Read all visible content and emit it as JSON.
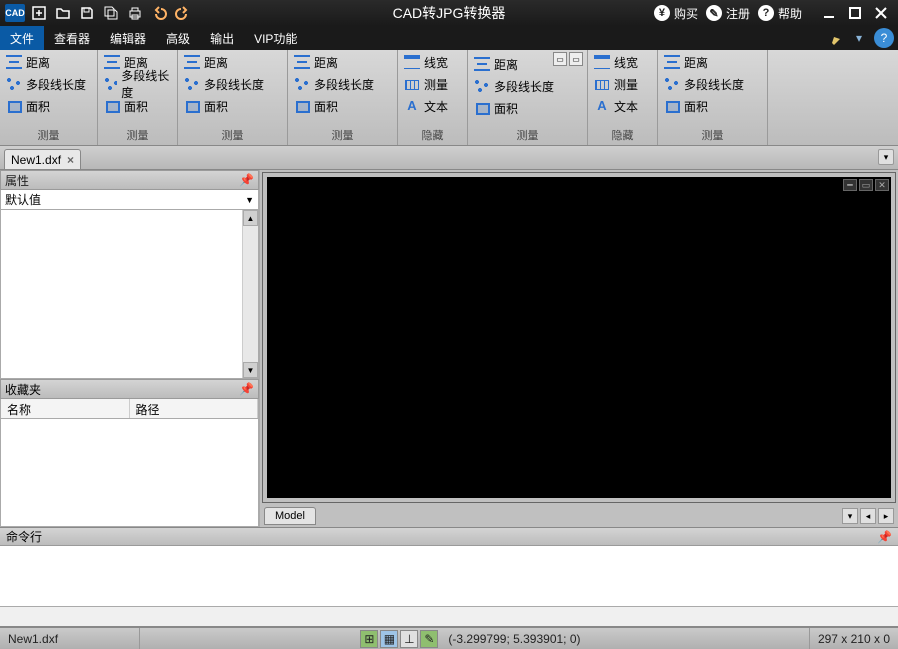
{
  "title": "CAD转JPG转换器",
  "titlebar_right": {
    "buy": "购买",
    "register": "注册",
    "help": "帮助"
  },
  "menu": {
    "file": "文件",
    "viewer": "查看器",
    "editor": "编辑器",
    "advanced": "高级",
    "output": "输出",
    "vip": "VIP功能"
  },
  "ribbon": {
    "distance": "距离",
    "polylen": "多段线长度",
    "area": "面积",
    "linewidth": "线宽",
    "measure": "测量",
    "text": "文本",
    "hide": "隐藏",
    "measure_group": "测量"
  },
  "doc": {
    "tab": "New1.dxf"
  },
  "panels": {
    "properties": "属性",
    "default_value": "默认值",
    "favorites": "收藏夹",
    "col_name": "名称",
    "col_path": "路径",
    "command": "命令行"
  },
  "viewport": {
    "model_tab": "Model"
  },
  "status": {
    "file": "New1.dxf",
    "coords": "(-3.299799; 5.393901; 0)",
    "dims": "297 x 210 x 0"
  }
}
